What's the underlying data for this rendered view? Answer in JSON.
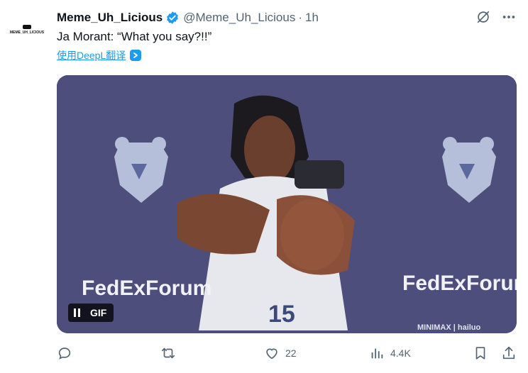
{
  "author": {
    "name": "Meme_Uh_Licious",
    "handle": "@Meme_Uh_Licious",
    "separator": "·",
    "time": "1h",
    "avatar_text": "MEME_UH_LICIOUS"
  },
  "tweet": {
    "text": "Ja Morant: “What you say?!!”",
    "translate_label": "使用DeepL翻译"
  },
  "media": {
    "type_label": "GIF",
    "left_banner": "FedExForum",
    "right_banner": "FedExForum",
    "jersey_number": "15",
    "watermark": "MINIMAX | hailuo"
  },
  "engagement": {
    "replies": "",
    "retweets": "",
    "likes": "22",
    "views": "4.4K"
  },
  "colors": {
    "accent": "#1d9bf0",
    "secondary_text": "#536471",
    "primary_text": "#0f1419",
    "backdrop": "#4a4a78"
  }
}
